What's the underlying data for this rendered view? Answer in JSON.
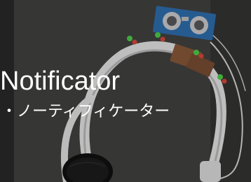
{
  "overlay": {
    "title": "Notificator",
    "subtitle": "・ノーティフィケーター"
  },
  "photo": {
    "subject": "white-headphones-with-ultrasonic-sensor-and-leds",
    "colors": {
      "background": "#3f3f3e",
      "headband": "#e9e9e9",
      "sensor_board": "#2f6fb0",
      "sensor_cans": "#cfcfd2",
      "led_green": "#4fd14a",
      "led_red": "#d9483a",
      "ear_pad": "#111111",
      "copper_board": "#8a5a3a"
    }
  }
}
